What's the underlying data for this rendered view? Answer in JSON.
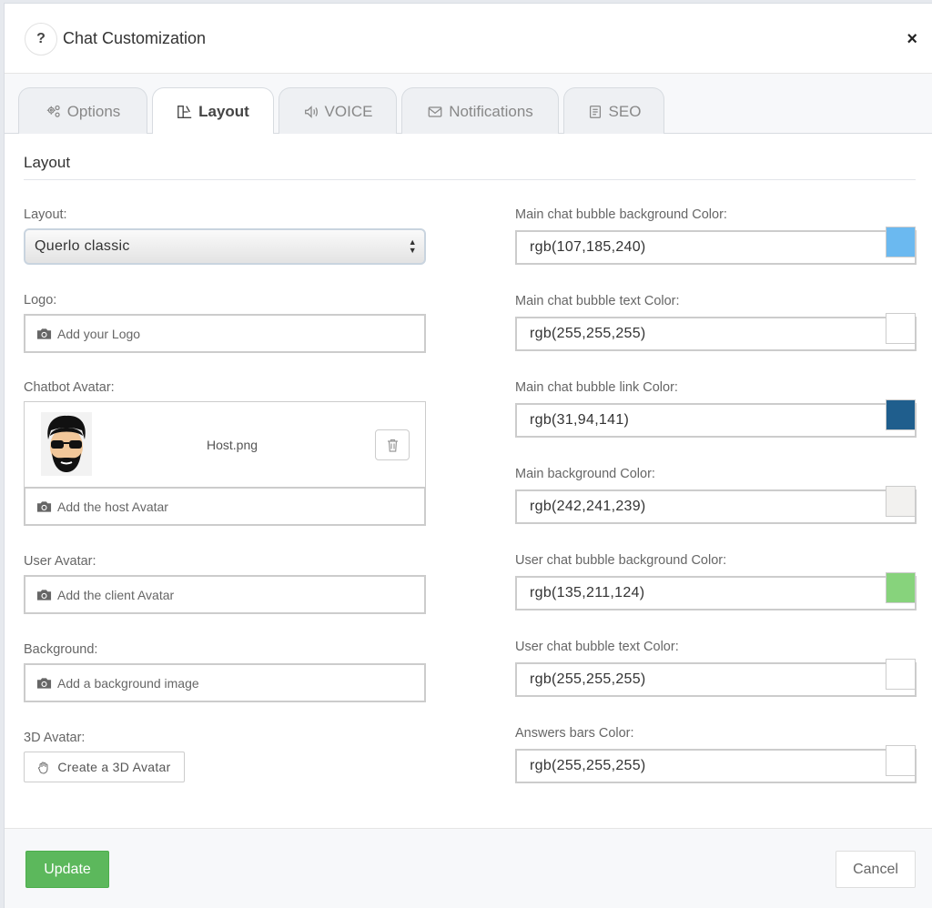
{
  "header": {
    "help": "?",
    "title": "Chat Customization",
    "close": "×"
  },
  "tabs": [
    {
      "label": "Options",
      "icon": "gears-icon"
    },
    {
      "label": "Layout",
      "icon": "layout-icon",
      "active": true
    },
    {
      "label": "VOICE",
      "icon": "speaker-icon"
    },
    {
      "label": "Notifications",
      "icon": "envelope-icon"
    },
    {
      "label": "SEO",
      "icon": "document-icon"
    }
  ],
  "section_title": "Layout",
  "left": {
    "layout_label": "Layout:",
    "layout_value": "Querlo classic",
    "logo_label": "Logo:",
    "logo_button": "Add your Logo",
    "chatbot_avatar_label": "Chatbot Avatar:",
    "chatbot_avatar_file": "Host.png",
    "host_avatar_button": "Add the host Avatar",
    "user_avatar_label": "User Avatar:",
    "user_avatar_button": "Add the client Avatar",
    "background_label": "Background:",
    "background_button": "Add a background image",
    "avatar3d_label": "3D Avatar:",
    "avatar3d_button": "Create a 3D Avatar"
  },
  "colors": [
    {
      "label": "Main chat bubble background Color:",
      "value": "rgb(107,185,240)",
      "swatch": "#6bb9f0"
    },
    {
      "label": "Main chat bubble text Color:",
      "value": "rgb(255,255,255)",
      "swatch": "#ffffff"
    },
    {
      "label": "Main chat bubble link Color:",
      "value": "rgb(31,94,141)",
      "swatch": "#1f5e8d"
    },
    {
      "label": "Main background Color:",
      "value": "rgb(242,241,239)",
      "swatch": "#f2f1ef"
    },
    {
      "label": "User chat bubble background Color:",
      "value": "rgb(135,211,124)",
      "swatch": "#87d37c"
    },
    {
      "label": "User chat bubble text Color:",
      "value": "rgb(255,255,255)",
      "swatch": "#ffffff"
    },
    {
      "label": "Answers bars Color:",
      "value": "rgb(255,255,255)",
      "swatch": "#ffffff"
    }
  ],
  "footer": {
    "update": "Update",
    "cancel": "Cancel"
  }
}
